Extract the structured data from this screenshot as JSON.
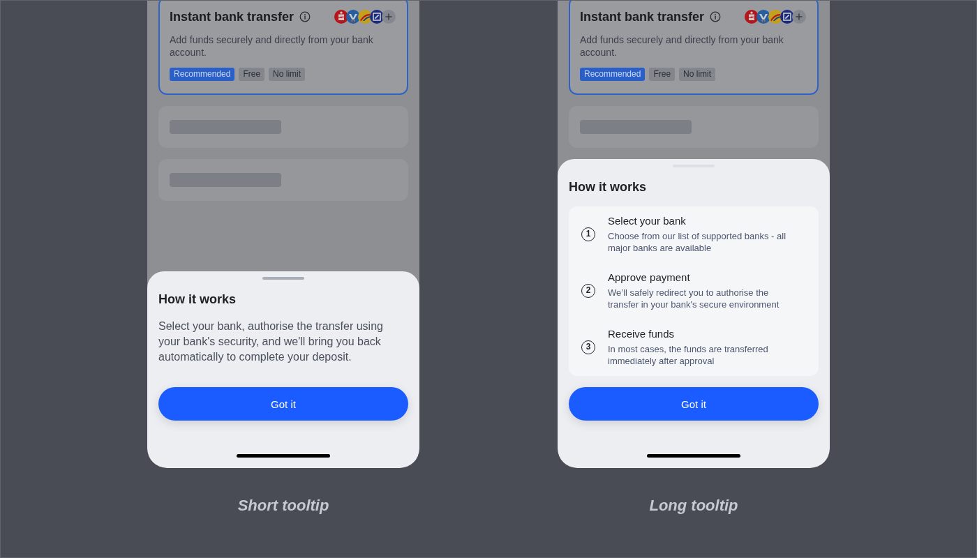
{
  "panels": [
    {
      "card": {
        "title": "Instant bank transfer",
        "selected": true,
        "description": "Add funds securely and directly from your bank account.",
        "tags": [
          {
            "label": "Recommended",
            "kind": "primary"
          },
          {
            "label": "Free",
            "kind": "neutral"
          },
          {
            "label": "No limit",
            "kind": "neutral"
          }
        ]
      },
      "sheet": {
        "kind": "short",
        "title": "How it works",
        "text": "Select your bank, authorise the transfer using your bank's security, and we'll bring you back automatically to complete your deposit.",
        "button": "Got it"
      },
      "caption": "Short tooltip"
    },
    {
      "card": {
        "title": "Instant bank transfer",
        "selected": true,
        "description": "Add funds securely and directly from your bank account.",
        "tags": [
          {
            "label": "Recommended",
            "kind": "primary"
          },
          {
            "label": "Free",
            "kind": "neutral"
          },
          {
            "label": "No limit",
            "kind": "neutral"
          }
        ]
      },
      "sheet": {
        "kind": "long",
        "title": "How it works",
        "steps": [
          {
            "number": "1",
            "title": "Select your bank",
            "description": "Choose from our list of supported banks - all major banks are available"
          },
          {
            "number": "2",
            "title": "Approve payment",
            "description": "We’ll safely redirect you to authorise the transfer in your bank's secure environment"
          },
          {
            "number": "3",
            "title": "Receive funds",
            "description": "In most cases, the funds are transferred immediately after approval"
          }
        ],
        "button": "Got it"
      },
      "caption": "Long tooltip"
    }
  ]
}
